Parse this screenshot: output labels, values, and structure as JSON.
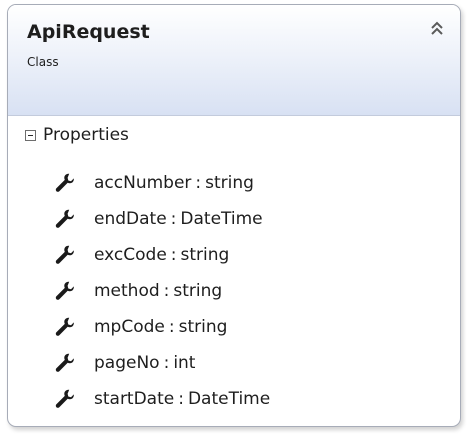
{
  "class_shape": {
    "name": "ApiRequest",
    "kind": "Class",
    "collapse_icon": "double-chevron-up-icon",
    "section": {
      "title": "Properties",
      "toggle_icon": "minus-box-icon",
      "member_icon": "wrench-icon",
      "separator": ":",
      "members": [
        {
          "name": "accNumber",
          "type": "string"
        },
        {
          "name": "endDate",
          "type": "DateTime"
        },
        {
          "name": "excCode",
          "type": "string"
        },
        {
          "name": "method",
          "type": "string"
        },
        {
          "name": "mpCode",
          "type": "string"
        },
        {
          "name": "pageNo",
          "type": "int"
        },
        {
          "name": "startDate",
          "type": "DateTime"
        }
      ]
    }
  },
  "colors": {
    "header_gradient_top": "#ffffff",
    "header_gradient_bottom": "#d8e1f3",
    "border": "#a7acb8",
    "text": "#1e1e1e"
  }
}
